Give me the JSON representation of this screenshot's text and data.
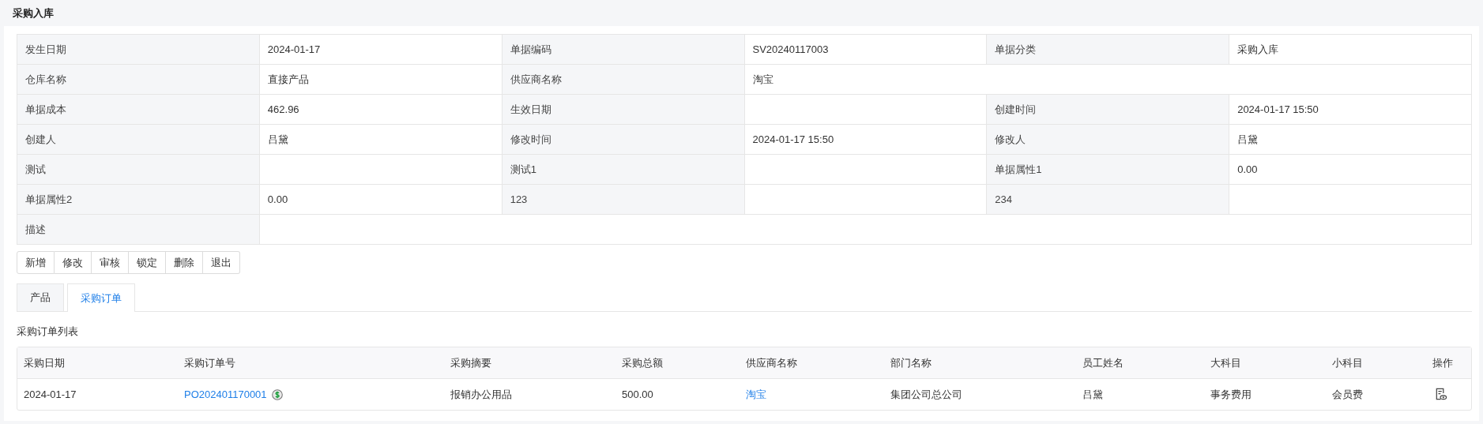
{
  "page_title": "采购入库",
  "details": [
    [
      {
        "text": "发生日期",
        "kind": "label"
      },
      {
        "text": "2024-01-17",
        "kind": "value"
      },
      {
        "text": "单据编码",
        "kind": "label"
      },
      {
        "text": "SV20240117003",
        "kind": "value"
      },
      {
        "text": "单据分类",
        "kind": "label"
      },
      {
        "text": "采购入库",
        "kind": "value"
      }
    ],
    [
      {
        "text": "仓库名称",
        "kind": "label"
      },
      {
        "text": "直接产品",
        "kind": "value"
      },
      {
        "text": "供应商名称",
        "kind": "label"
      },
      {
        "text": "淘宝",
        "kind": "value"
      }
    ],
    [
      {
        "text": "单据成本",
        "kind": "label"
      },
      {
        "text": "462.96",
        "kind": "value"
      },
      {
        "text": "生效日期",
        "kind": "label"
      },
      {
        "kind": "value"
      },
      {
        "text": "创建时间",
        "kind": "label"
      },
      {
        "text": "2024-01-17 15:50",
        "kind": "value"
      }
    ],
    [
      {
        "text": "创建人",
        "kind": "label"
      },
      {
        "text": "吕黛",
        "kind": "value"
      },
      {
        "text": "修改时间",
        "kind": "label"
      },
      {
        "text": "2024-01-17 15:50",
        "kind": "value"
      },
      {
        "text": "修改人",
        "kind": "label"
      },
      {
        "text": "吕黛",
        "kind": "value"
      }
    ],
    [
      {
        "text": "测试",
        "kind": "label"
      },
      {
        "kind": "value"
      },
      {
        "text": "测试1",
        "kind": "label"
      },
      {
        "kind": "value"
      },
      {
        "text": "单据属性1",
        "kind": "label"
      },
      {
        "text": "0.00",
        "kind": "value"
      }
    ],
    [
      {
        "text": "单据属性2",
        "kind": "label"
      },
      {
        "text": "0.00",
        "kind": "value"
      },
      {
        "text": "123",
        "kind": "label"
      },
      {
        "kind": "value"
      },
      {
        "text": "234",
        "kind": "label"
      },
      {
        "kind": "value"
      }
    ],
    [
      {
        "text": "描述",
        "kind": "label"
      },
      {
        "kind": "value"
      }
    ]
  ],
  "buttons": [
    "新增",
    "修改",
    "审核",
    "锁定",
    "删除",
    "退出"
  ],
  "tabs": [
    {
      "label": "产品",
      "selected": false
    },
    {
      "label": "采购订单",
      "selected": true
    }
  ],
  "list_title": "采购订单列表",
  "table": {
    "columns": [
      "采购日期",
      "采购订单号",
      "采购摘要",
      "采购总额",
      "供应商名称",
      "部门名称",
      "员工姓名",
      "大科目",
      "小科目",
      "操作"
    ],
    "rows": [
      {
        "date": "2024-01-17",
        "order_no": "PO202401170001",
        "summary": "报销办公用品",
        "total": "500.00",
        "supplier": "淘宝",
        "department": "集团公司总公司",
        "employee": "吕黛",
        "major": "事务费用",
        "minor": "会员费"
      }
    ]
  }
}
